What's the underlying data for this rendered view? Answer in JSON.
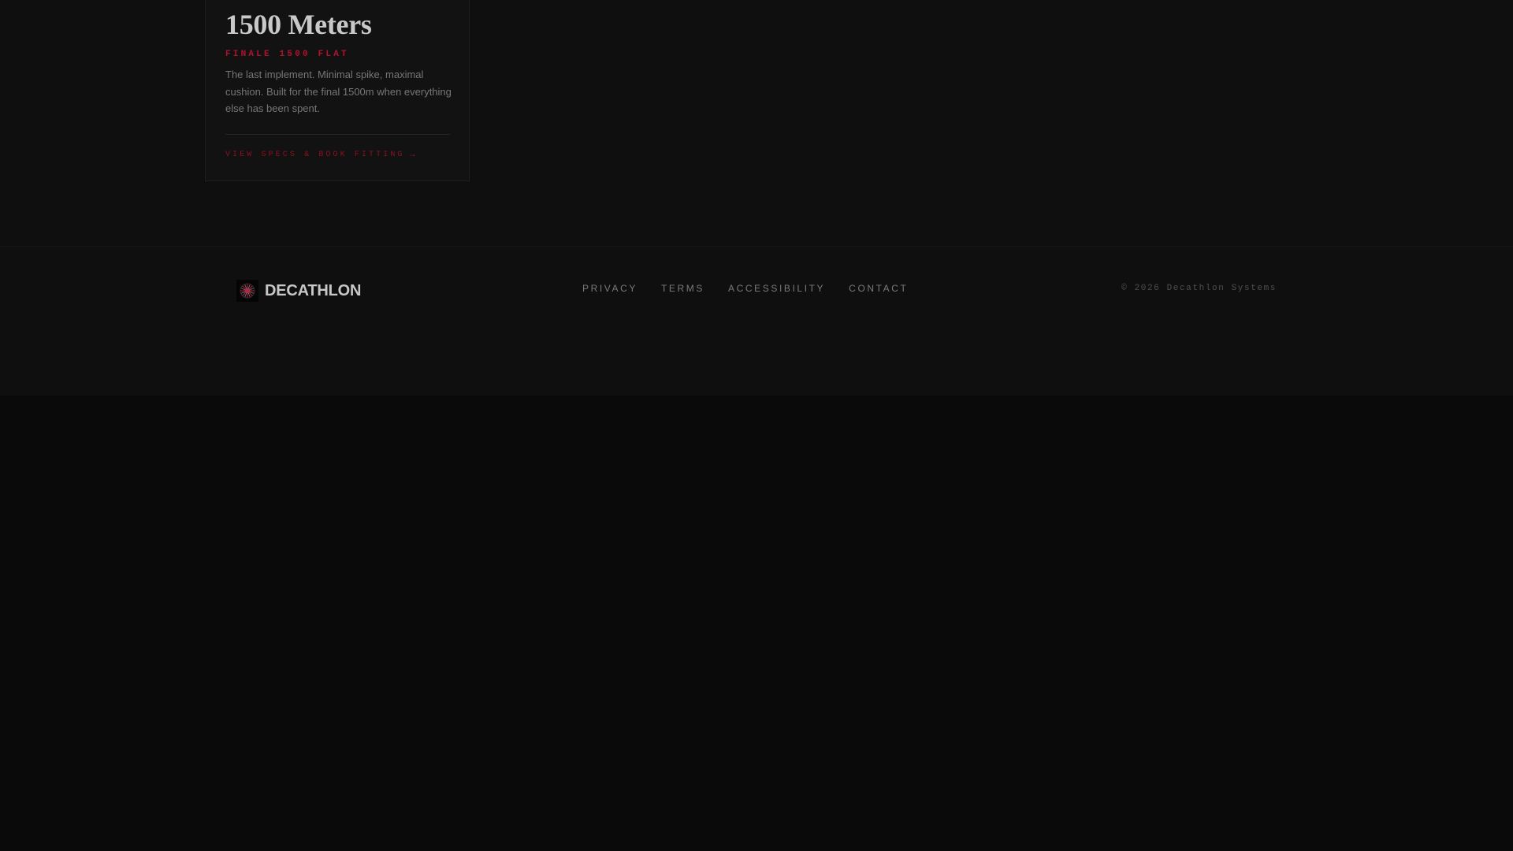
{
  "card": {
    "title": "1500 Meters",
    "tag": "FINALE 1500 FLAT",
    "description": "The last implement. Minimal spike, maximal cushion. Built for the final 1500m when everything else has been spent.",
    "link_label": "VIEW SPECS & BOOK FITTING",
    "link_arrow": "→"
  },
  "footer": {
    "brand_name": "DECATHLON",
    "brand_icon": "starburst-logo-icon",
    "nav": {
      "privacy": "PRIVACY",
      "terms": "TERMS",
      "accessibility": "ACCESSIBILITY",
      "contact": "CONTACT"
    },
    "copyright": "© 2026 Decathlon Systems"
  },
  "colors": {
    "accent": "#b1122d",
    "background": "#0b0b0b",
    "card": "#121212"
  }
}
